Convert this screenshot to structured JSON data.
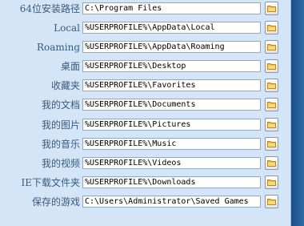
{
  "rows": [
    {
      "label": "64位安装路径",
      "value": "C:\\Program Files"
    },
    {
      "label": "Local",
      "value": "%USERPROFILE%\\AppData\\Local"
    },
    {
      "label": "Roaming",
      "value": "%USERPROFILE%\\AppData\\Roaming"
    },
    {
      "label": "桌面",
      "value": "%USERPROFILE%\\Desktop"
    },
    {
      "label": "收藏夹",
      "value": "%USERPROFILE%\\Favorites"
    },
    {
      "label": "我的文档",
      "value": "%USERPROFILE%\\Documents"
    },
    {
      "label": "我的图片",
      "value": "%USERPROFILE%\\Pictures"
    },
    {
      "label": "我的音乐",
      "value": "%USERPROFILE%\\Music"
    },
    {
      "label": "我的视频",
      "value": "%USERPROFILE%\\Videos"
    },
    {
      "label": "IE下载文件夹",
      "value": "%USERPROFILE%\\Downloads"
    },
    {
      "label": "保存的游戏",
      "value": "C:\\Users\\Administrator\\Saved Games"
    }
  ],
  "icons": {
    "browse": "folder-icon"
  },
  "colors": {
    "panel_background": "#d4e5f7",
    "label_text": "#3a5a7c",
    "window_frame": "#2b5f99",
    "folder_fill": "#f2c24a"
  }
}
